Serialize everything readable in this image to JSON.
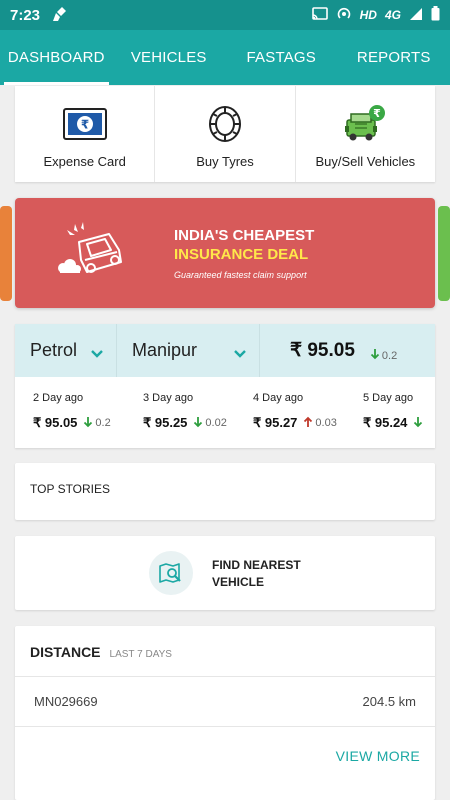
{
  "status": {
    "time": "7:23",
    "hd": "HD",
    "network": "4G"
  },
  "tabs": [
    {
      "label": "DASHBOARD",
      "active": true
    },
    {
      "label": "VEHICLES"
    },
    {
      "label": "FASTAGS"
    },
    {
      "label": "REPORTS"
    }
  ],
  "quick_actions": [
    {
      "label": "Expense Card",
      "icon": "rupee-card-icon"
    },
    {
      "label": "Buy Tyres",
      "icon": "tyre-icon"
    },
    {
      "label": "Buy/Sell Vehicles",
      "icon": "vehicle-sell-icon"
    }
  ],
  "banner": {
    "line1": "INDIA'S CHEAPEST",
    "line2": "INSURANCE DEAL",
    "tagline": "Guaranteed fastest claim support",
    "bg_color": "#d75a5a",
    "highlight_color": "#ffe84a"
  },
  "fuel": {
    "fuel_type": "Petrol",
    "state": "Manipur",
    "price": "₹ 95.05",
    "change": "0.2",
    "history": [
      {
        "day": "2 Day ago",
        "price": "₹ 95.05",
        "change": "0.2",
        "dir": "down"
      },
      {
        "day": "3 Day ago",
        "price": "₹ 95.25",
        "change": "0.02",
        "dir": "down"
      },
      {
        "day": "4 Day ago",
        "price": "₹ 95.27",
        "change": "0.03",
        "dir": "up"
      },
      {
        "day": "5 Day ago",
        "price": "₹ 95.24",
        "change": "",
        "dir": "down"
      }
    ]
  },
  "top_stories": {
    "title": "TOP STORIES"
  },
  "find_vehicle": {
    "line1": "FIND NEAREST",
    "line2": "VEHICLE"
  },
  "distance": {
    "title": "DISTANCE",
    "subtitle": "LAST 7 DAYS",
    "vehicle": "MN029669",
    "value": "204.5 km",
    "view_more": "VIEW MORE"
  },
  "colors": {
    "primary": "#1ba8a4",
    "status_bar": "#15918d",
    "down": "#2e9e3e",
    "up": "#c0392b"
  }
}
